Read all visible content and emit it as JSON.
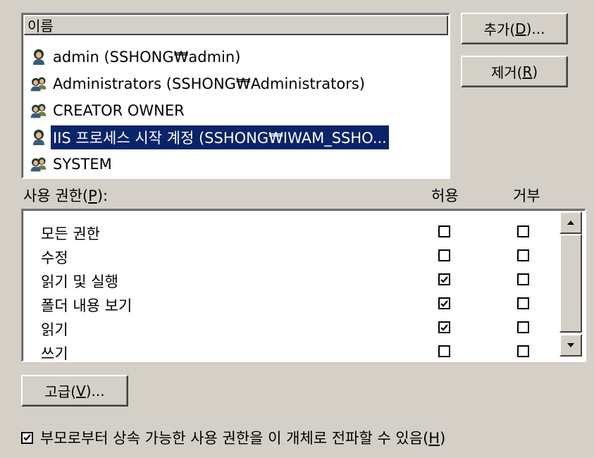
{
  "users": {
    "column_header": "이름",
    "items": [
      {
        "label": "admin (SSHONG₩admin)",
        "icon": "user-icon",
        "selected": false
      },
      {
        "label": "Administrators (SSHONG₩Administrators)",
        "icon": "group-icon",
        "selected": false
      },
      {
        "label": "CREATOR OWNER",
        "icon": "group-icon",
        "selected": false
      },
      {
        "label": "IIS 프로세스 시작 계정 (SSHONG₩IWAM_SSHO...",
        "icon": "user-icon",
        "selected": true
      },
      {
        "label": "SYSTEM",
        "icon": "group-icon",
        "selected": false
      }
    ]
  },
  "buttons": {
    "add_prefix": "추가(",
    "add_key": "D",
    "add_suffix": ")...",
    "remove_prefix": "제거(",
    "remove_key": "R",
    "remove_suffix": ")",
    "advanced_prefix": "고급(",
    "advanced_key": "V",
    "advanced_suffix": ")..."
  },
  "permissions": {
    "label_prefix": "사용 권한(",
    "label_key": "P",
    "label_suffix": "):",
    "allow_header": "허용",
    "deny_header": "거부",
    "rows": [
      {
        "name": "모든 권한",
        "allow": false,
        "deny": false
      },
      {
        "name": "수정",
        "allow": false,
        "deny": false
      },
      {
        "name": "읽기 및 실행",
        "allow": true,
        "deny": false
      },
      {
        "name": "폴더 내용 보기",
        "allow": true,
        "deny": false
      },
      {
        "name": "읽기",
        "allow": true,
        "deny": false
      },
      {
        "name": "쓰기",
        "allow": false,
        "deny": false
      }
    ]
  },
  "inherit": {
    "checked": true,
    "label_prefix": "부모로부터 상속 가능한 사용 권한을 이 개체로 전파할 수 있음(",
    "label_key": "H",
    "label_suffix": ")"
  },
  "colors": {
    "selection": "#0a246a",
    "face": "#d4d0c8"
  }
}
